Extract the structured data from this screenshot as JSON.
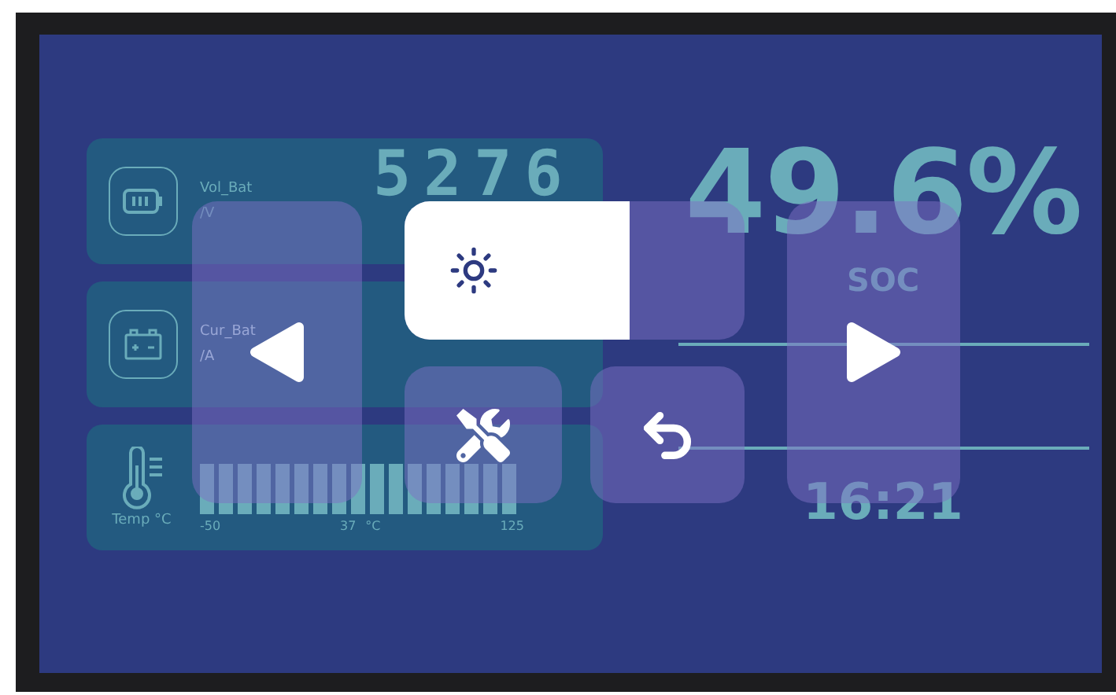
{
  "cards": [
    {
      "kind": "battery",
      "label": "Vol_Bat",
      "unit": "/V",
      "value": "5276"
    },
    {
      "kind": "car-battery",
      "label": "Cur_Bat",
      "unit": "/A"
    }
  ],
  "temperature": {
    "label": "Temp °C",
    "min": "-50",
    "value": "37",
    "unit": "°C",
    "max": "125"
  },
  "soc": {
    "value": "49.6%",
    "label": "SOC"
  },
  "time": "16:21",
  "menu": {
    "brightness": {
      "level": 0.66
    }
  }
}
